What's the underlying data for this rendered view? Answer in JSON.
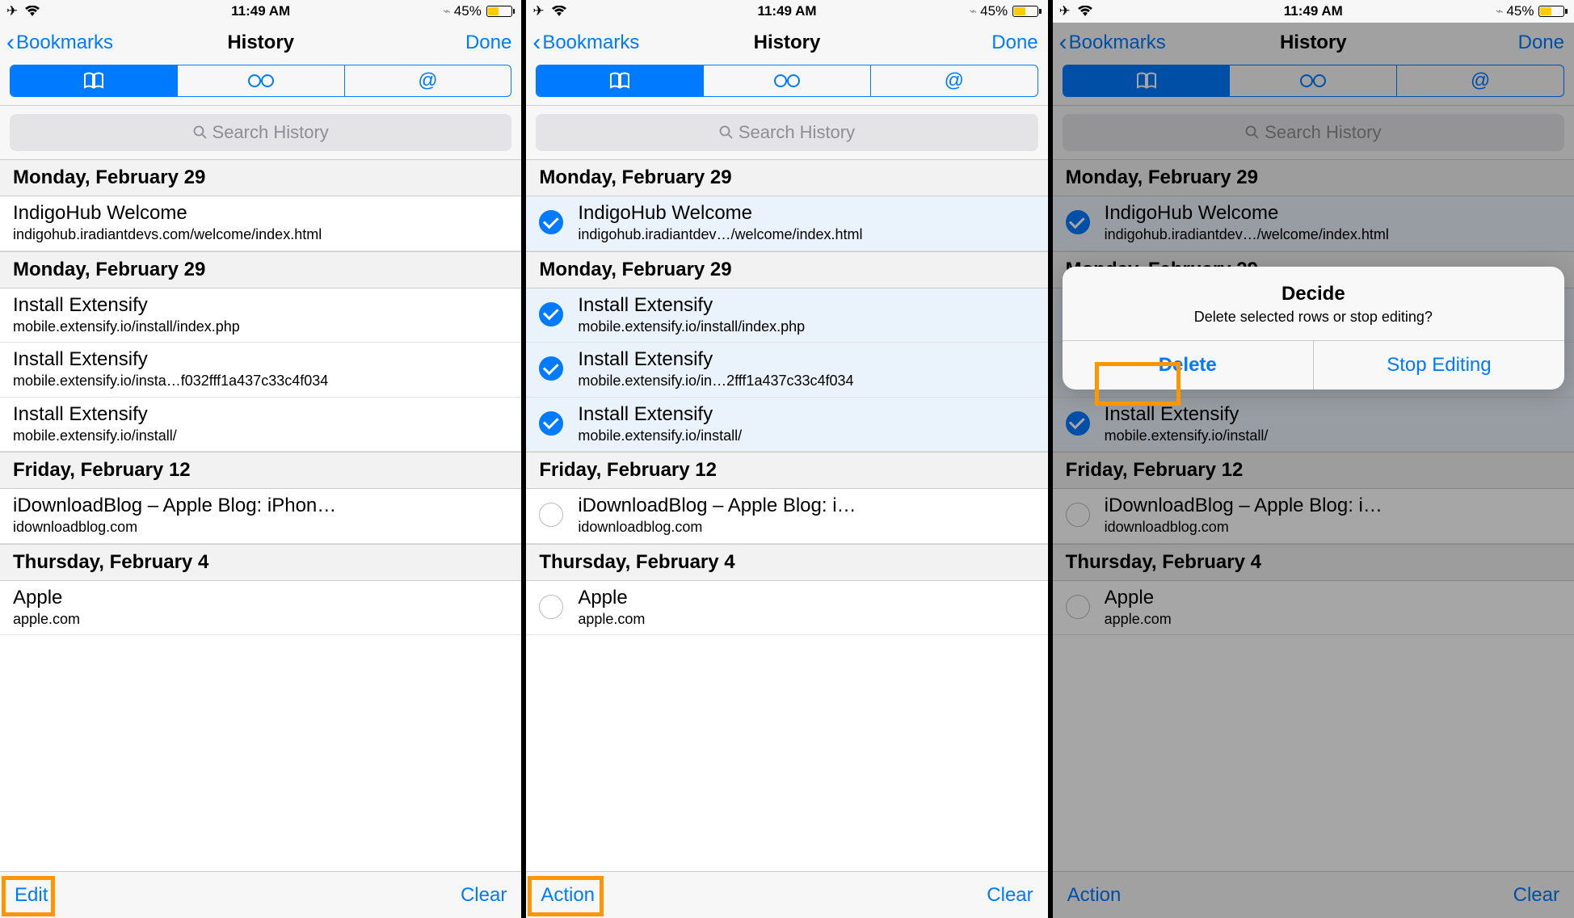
{
  "status_bar": {
    "time": "11:49 AM",
    "battery_pct": "45%"
  },
  "nav": {
    "back_label": "Bookmarks",
    "title": "History",
    "done_label": "Done"
  },
  "search": {
    "placeholder": "Search History"
  },
  "sections_plain": [
    {
      "header": "Monday, February 29",
      "rows": [
        {
          "title": "IndigoHub Welcome",
          "sub": "indigohub.iradiantdevs.com/welcome/index.html"
        }
      ]
    },
    {
      "header": "Monday, February 29",
      "rows": [
        {
          "title": "Install Extensify",
          "sub": "mobile.extensify.io/install/index.php"
        },
        {
          "title": "Install Extensify",
          "sub": "mobile.extensify.io/insta…f032fff1a437c33c4f034"
        },
        {
          "title": "Install Extensify",
          "sub": "mobile.extensify.io/install/"
        }
      ]
    },
    {
      "header": "Friday, February 12",
      "rows": [
        {
          "title": "iDownloadBlog – Apple Blog: iPhon…",
          "sub": "idownloadblog.com"
        }
      ]
    },
    {
      "header": "Thursday, February 4",
      "rows": [
        {
          "title": "Apple",
          "sub": "apple.com"
        }
      ]
    }
  ],
  "sections_edit": [
    {
      "header": "Monday, February 29",
      "rows": [
        {
          "title": "IndigoHub Welcome",
          "sub": "indigohub.iradiantdev…/welcome/index.html",
          "checked": true
        }
      ]
    },
    {
      "header": "Monday, February 29",
      "rows": [
        {
          "title": "Install Extensify",
          "sub": "mobile.extensify.io/install/index.php",
          "checked": true
        },
        {
          "title": "Install Extensify",
          "sub": "mobile.extensify.io/in…2fff1a437c33c4f034",
          "checked": true
        },
        {
          "title": "Install Extensify",
          "sub": "mobile.extensify.io/install/",
          "checked": true
        }
      ]
    },
    {
      "header": "Friday, February 12",
      "rows": [
        {
          "title": "iDownloadBlog – Apple Blog: i…",
          "sub": "idownloadblog.com",
          "checked": false
        }
      ]
    },
    {
      "header": "Thursday, February 4",
      "rows": [
        {
          "title": "Apple",
          "sub": "apple.com",
          "checked": false
        }
      ]
    }
  ],
  "toolbar": {
    "edit": "Edit",
    "action": "Action",
    "clear": "Clear"
  },
  "alert": {
    "title": "Decide",
    "message": "Delete selected rows or stop editing?",
    "delete": "Delete",
    "stop": "Stop Editing"
  }
}
